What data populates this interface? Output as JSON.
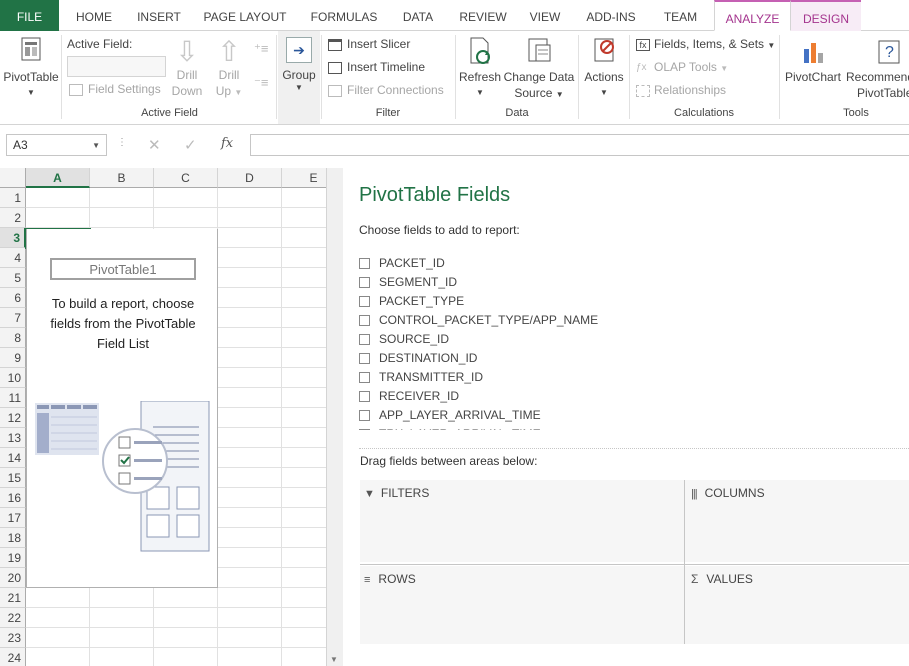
{
  "tabs": [
    "FILE",
    "HOME",
    "INSERT",
    "PAGE LAYOUT",
    "FORMULAS",
    "DATA",
    "REVIEW",
    "VIEW",
    "ADD-INS",
    "TEAM",
    "ANALYZE",
    "DESIGN"
  ],
  "ribbon": {
    "pivottable": "PivotTable",
    "active_field_label": "Active Field:",
    "field_settings": "Field Settings",
    "drill_down_1": "Drill",
    "drill_down_2": "Down",
    "drill_up_1": "Drill",
    "drill_up_2": "Up",
    "group_active_field": "Active Field",
    "group": "Group",
    "insert_slicer": "Insert Slicer",
    "insert_timeline": "Insert Timeline",
    "filter_connections": "Filter Connections",
    "group_filter": "Filter",
    "refresh": "Refresh",
    "change_data_source_1": "Change Data",
    "change_data_source_2": "Source",
    "group_data": "Data",
    "actions": "Actions",
    "fields_items_sets": "Fields, Items, & Sets",
    "olap_tools": "OLAP Tools",
    "relationships": "Relationships",
    "group_calculations": "Calculations",
    "pivotchart": "PivotChart",
    "recommended_1": "Recommended",
    "recommended_2": "PivotTables",
    "group_tools": "Tools"
  },
  "formula_bar": {
    "name_box": "A3",
    "fx": "fx"
  },
  "grid": {
    "columns": [
      "A",
      "B",
      "C",
      "D",
      "E"
    ],
    "rows": [
      "1",
      "2",
      "3",
      "4",
      "5",
      "6",
      "7",
      "8",
      "9",
      "10",
      "11",
      "12",
      "13",
      "14",
      "15",
      "16",
      "17",
      "18",
      "19",
      "20",
      "21",
      "22",
      "23",
      "24"
    ],
    "selected_cell": "A3"
  },
  "pivot_placeholder": {
    "name": "PivotTable1",
    "line1": "To build a report, choose",
    "line2": "fields from the PivotTable",
    "line3": "Field List"
  },
  "field_pane": {
    "title": "PivotTable Fields",
    "choose_label": "Choose fields to add to report:",
    "fields": [
      "PACKET_ID",
      "SEGMENT_ID",
      "PACKET_TYPE",
      "CONTROL_PACKET_TYPE/APP_NAME",
      "SOURCE_ID",
      "DESTINATION_ID",
      "TRANSMITTER_ID",
      "RECEIVER_ID",
      "APP_LAYER_ARRIVAL_TIME",
      "TRX_LAYER_ARRIVAL_TIME"
    ],
    "drag_label": "Drag fields between areas below:",
    "filters": "FILTERS",
    "columns": "COLUMNS",
    "rows": "ROWS",
    "values": "VALUES"
  }
}
